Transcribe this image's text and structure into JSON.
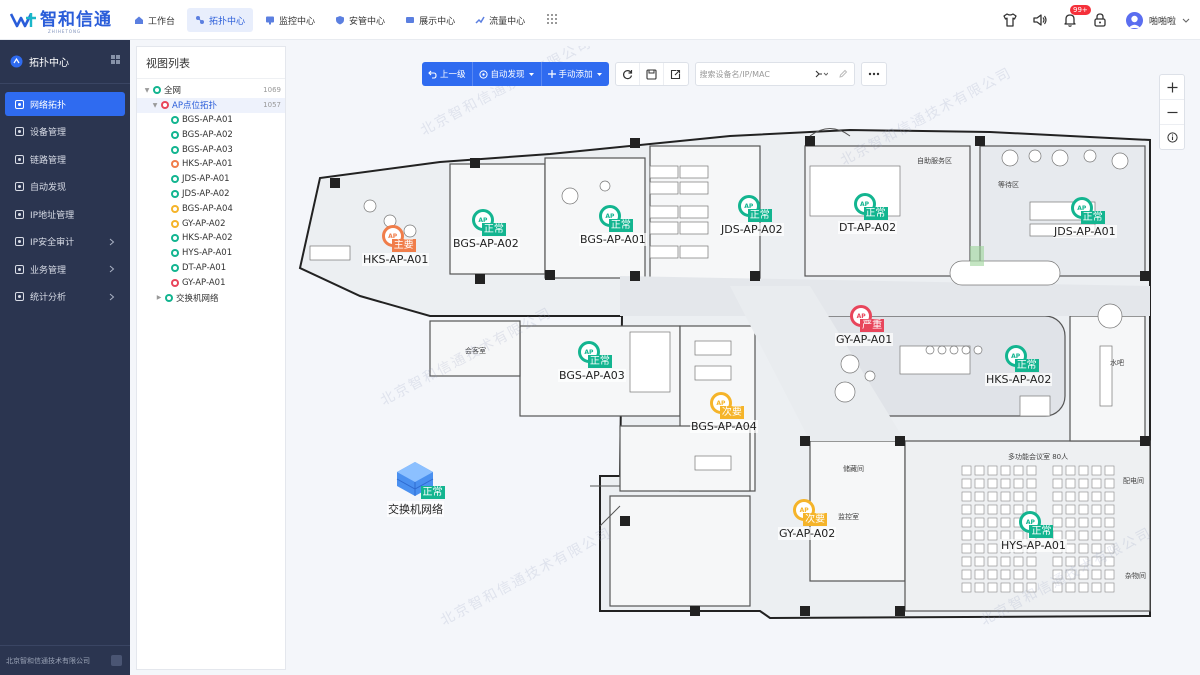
{
  "brand": {
    "name": "智和信通",
    "sub": "ZHIHETONG"
  },
  "topnav": [
    {
      "label": "工作台",
      "icon": "home-icon",
      "active": false
    },
    {
      "label": "拓扑中心",
      "icon": "topology-icon",
      "active": true
    },
    {
      "label": "监控中心",
      "icon": "monitor-icon",
      "active": false
    },
    {
      "label": "安管中心",
      "icon": "shield-icon",
      "active": false
    },
    {
      "label": "展示中心",
      "icon": "display-icon",
      "active": false
    },
    {
      "label": "流量中心",
      "icon": "flow-icon",
      "active": false
    }
  ],
  "header_right": {
    "notification_badge": "99+",
    "user_name": "啪啪啦"
  },
  "sidebar": {
    "title": "拓扑中心",
    "items": [
      {
        "label": "网络拓扑",
        "icon": "topology-icon",
        "active": true,
        "expandable": false
      },
      {
        "label": "设备管理",
        "icon": "device-icon",
        "active": false,
        "expandable": false
      },
      {
        "label": "链路管理",
        "icon": "link-icon",
        "active": false,
        "expandable": false
      },
      {
        "label": "自动发现",
        "icon": "discover-icon",
        "active": false,
        "expandable": false
      },
      {
        "label": "IP地址管理",
        "icon": "ip-icon",
        "active": false,
        "expandable": false
      },
      {
        "label": "IP安全审计",
        "icon": "audit-icon",
        "active": false,
        "expandable": true
      },
      {
        "label": "业务管理",
        "icon": "business-icon",
        "active": false,
        "expandable": true
      },
      {
        "label": "统计分析",
        "icon": "stats-icon",
        "active": false,
        "expandable": true
      }
    ],
    "footer": "北京智和信通技术有限公司"
  },
  "view_list": {
    "title": "视图列表",
    "root": {
      "label": "全网",
      "count": "1069"
    },
    "group": {
      "label": "AP点位拓扑",
      "count": "1057"
    },
    "children": [
      {
        "label": "BGS-AP-A01",
        "status": "normal"
      },
      {
        "label": "BGS-AP-A02",
        "status": "normal"
      },
      {
        "label": "BGS-AP-A03",
        "status": "normal"
      },
      {
        "label": "HKS-AP-A01",
        "status": "major"
      },
      {
        "label": "JDS-AP-A01",
        "status": "normal"
      },
      {
        "label": "JDS-AP-A02",
        "status": "normal"
      },
      {
        "label": "BGS-AP-A04",
        "status": "minor"
      },
      {
        "label": "GY-AP-A02",
        "status": "minor"
      },
      {
        "label": "HKS-AP-A02",
        "status": "normal"
      },
      {
        "label": "HYS-AP-A01",
        "status": "normal"
      },
      {
        "label": "DT-AP-A01",
        "status": "normal"
      },
      {
        "label": "GY-AP-A01",
        "status": "critical"
      }
    ],
    "switch_group": {
      "label": "交换机网络"
    }
  },
  "toolbar": {
    "up_label": "上一级",
    "discover_label": "自动发现",
    "add_label": "手动添加",
    "search_placeholder": "搜索设备名/IP/MAC"
  },
  "status_colors": {
    "normal": "#13b590",
    "major": "#f07d4a",
    "minor": "#f5b42a",
    "critical": "#e8455b"
  },
  "status_labels": {
    "normal": "正常",
    "major": "主要",
    "minor": "次要",
    "critical": "严重"
  },
  "ap_icon_text": "AP",
  "map_aps": [
    {
      "name": "HKS-AP-A01",
      "status": "major"
    },
    {
      "name": "BGS-AP-A02",
      "status": "normal"
    },
    {
      "name": "BGS-AP-A01",
      "status": "normal"
    },
    {
      "name": "JDS-AP-A02",
      "status": "normal"
    },
    {
      "name": "DT-AP-A02",
      "status": "normal"
    },
    {
      "name": "JDS-AP-A01",
      "status": "normal"
    },
    {
      "name": "GY-AP-A01",
      "status": "critical"
    },
    {
      "name": "BGS-AP-A03",
      "status": "normal"
    },
    {
      "name": "HKS-AP-A02",
      "status": "normal"
    },
    {
      "name": "BGS-AP-A04",
      "status": "minor"
    },
    {
      "name": "GY-AP-A02",
      "status": "minor"
    },
    {
      "name": "HYS-AP-A01",
      "status": "normal"
    }
  ],
  "switch_node": {
    "name": "交换机网络",
    "status": "normal"
  },
  "rooms": {
    "self_service": "自助服务区",
    "waiting": "等待区",
    "reception": "会客室",
    "bar": "水吧",
    "storage": "储藏间",
    "control": "监控室",
    "meeting": "多功能会议室 80人",
    "power": "配电间",
    "misc": "杂物间"
  },
  "watermark": "北京智和信通技术有限公司"
}
